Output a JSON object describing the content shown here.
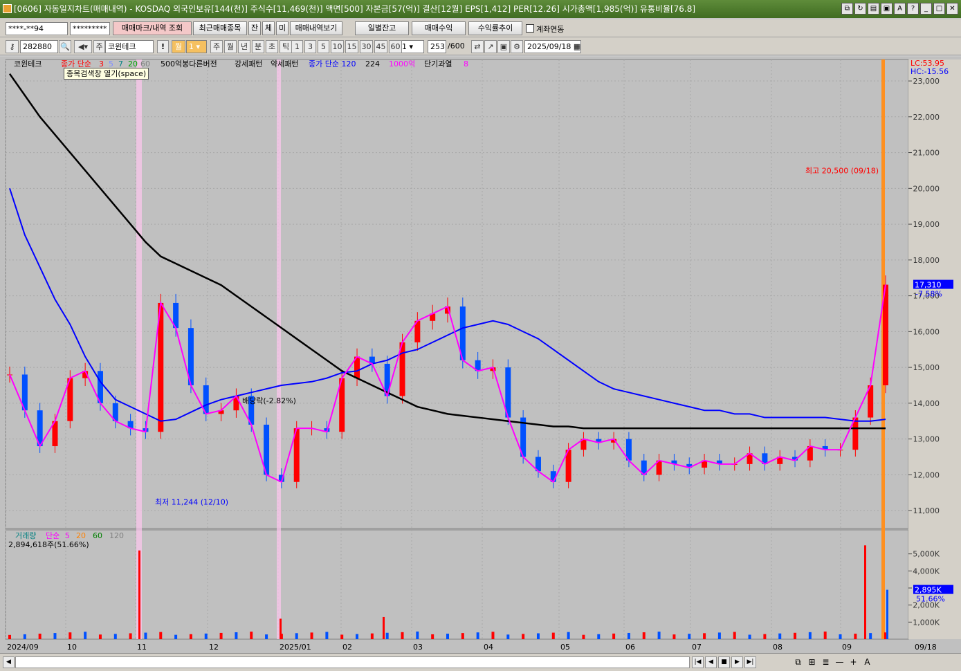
{
  "window": {
    "title": "[0606] 자동일지차트(매매내역) - KOSDAQ 외국인보유[144(천)] 주식수[11,469(천)] 액면[500] 자본금[57(억)] 결산[12월] EPS[1,412] PER[12.26] 시가총액[1,985(억)] 유통비율[76.8]"
  },
  "toolbar1": {
    "account": "****-**94",
    "password": "*********",
    "btn_mark": "매매마크/내역 조회",
    "btn_recent": "최근매매종목",
    "btn_jan": "잔",
    "btn_che": "체",
    "btn_mi": "미",
    "btn_detail": "매매내역보기",
    "btn_daily": "일별잔고",
    "btn_profit": "매매수익",
    "btn_rate": "수익률추이",
    "chk_account": "계좌연동"
  },
  "toolbar2": {
    "code": "282880",
    "name": "코윈테크",
    "cycle_selected": "월",
    "cycle_count": "1",
    "cycles": [
      "주",
      "월",
      "년",
      "분",
      "초",
      "틱"
    ],
    "minutes": [
      "1",
      "3",
      "5",
      "10",
      "15",
      "30",
      "45",
      "60"
    ],
    "min_value": "1",
    "count": "253",
    "count_max": "/600",
    "date": "2025/09/18",
    "tooltip": "종목검색창 열기(space)",
    "exclaim": "!",
    "prefix": "주"
  },
  "legend": {
    "stock": "코윈테크",
    "ma_label": "종가 단순",
    "ma_periods": [
      "3",
      "5",
      "7",
      "20",
      "60"
    ],
    "indicators": [
      "500억봉다른버전",
      "강세패턴",
      "약세패턴"
    ],
    "ma120": "종가 단순 120",
    "ma224": "224",
    "ma1000": "1000억",
    "short_label": "단기과열",
    "short_val": "8"
  },
  "price_axis": {
    "lc": "LC:53.95",
    "hc": "HC:-15.56",
    "current": "17,310",
    "change": "-7.58%",
    "ticks": [
      "23,000",
      "22,000",
      "21,000",
      "20,000",
      "19,000",
      "18,000",
      "17,000",
      "16,000",
      "15,000",
      "14,000",
      "13,000",
      "12,000",
      "11,000"
    ]
  },
  "annotations": {
    "high": "최고 20,500 (09/18)",
    "low": "최저 11,244 (12/10)",
    "dividend": "배당락(-2.82%)"
  },
  "volume": {
    "title": "거래량",
    "ma_label": "단순",
    "ma_periods": [
      "5",
      "20",
      "60",
      "120"
    ],
    "current": "2,894,618주(51.66%)",
    "axis_current": "2,895K",
    "axis_pct": "51.66%",
    "ticks": [
      "5,000K",
      "4,000K",
      "3,000K",
      "2,000K",
      "1,000K"
    ]
  },
  "x_axis": {
    "labels": [
      "2024/09",
      "10",
      "11",
      "12",
      "2025/01",
      "02",
      "03",
      "04",
      "05",
      "06",
      "07",
      "08",
      "09"
    ],
    "last": "09/18"
  },
  "colors": {
    "ma3": "#ff0000",
    "ma5": "#8090ff",
    "ma7": "#a0a0a0",
    "ma20": "#00a000",
    "ma60": "#a0a0a0",
    "ma120": "#0000ff",
    "ma224": "#000000",
    "ma1000": "#ff00ff",
    "short": "#ff00ff",
    "dividend": "#ff8080",
    "trade_buy": "#ff0000",
    "trade_sell": "#0000ff"
  },
  "chart_data": {
    "type": "candlestick",
    "title": "코윈테크",
    "x": [
      "2024/09",
      "10",
      "11",
      "12",
      "2025/01",
      "02",
      "03",
      "04",
      "05",
      "06",
      "07",
      "08",
      "09"
    ],
    "ylim": [
      10500,
      23600
    ],
    "series": [
      {
        "name": "종가",
        "values": [
          14800,
          13800,
          12800,
          13500,
          14700,
          14900,
          14000,
          13500,
          13300,
          13200,
          16800,
          16100,
          14500,
          13700,
          13800,
          14200,
          13400,
          12000,
          11800,
          13300,
          13300,
          13200,
          14700,
          15300,
          15100,
          14200,
          15700,
          16300,
          16500,
          16700,
          15200,
          14900,
          15000,
          13600,
          12500,
          12100,
          11800,
          12700,
          13000,
          12900,
          13000,
          12400,
          12000,
          12400,
          12300,
          12200,
          12400,
          12300,
          12300,
          12600,
          12300,
          12500,
          12400,
          12800,
          12700,
          12700,
          13600,
          14500,
          17310
        ]
      },
      {
        "name": "종가 단순 120",
        "values": [
          20000,
          18700,
          17800,
          16900,
          16200,
          15300,
          14600,
          14100,
          13900,
          13700,
          13500,
          13550,
          13750,
          13950,
          14100,
          14200,
          14300,
          14400,
          14500,
          14550,
          14600,
          14700,
          14850,
          14900,
          15100,
          15200,
          15400,
          15500,
          15700,
          15900,
          16100,
          16200,
          16300,
          16200,
          16000,
          15800,
          15500,
          15200,
          14900,
          14600,
          14400,
          14300,
          14200,
          14100,
          14000,
          13900,
          13800,
          13800,
          13700,
          13700,
          13600,
          13600,
          13600,
          13600,
          13600,
          13550,
          13500,
          13500,
          13550
        ]
      },
      {
        "name": "224",
        "values": [
          23200,
          22600,
          22000,
          21500,
          21000,
          20500,
          20000,
          19500,
          19000,
          18500,
          18100,
          17900,
          17700,
          17500,
          17300,
          17000,
          16700,
          16400,
          16100,
          15800,
          15500,
          15200,
          14900,
          14700,
          14500,
          14300,
          14100,
          13900,
          13800,
          13700,
          13650,
          13600,
          13550,
          13500,
          13450,
          13400,
          13350,
          13350,
          13300,
          13300,
          13300,
          13300,
          13300,
          13300,
          13300,
          13300,
          13300,
          13300,
          13300,
          13300,
          13300,
          13300,
          13300,
          13300,
          13300,
          13300,
          13300,
          13300,
          13300
        ]
      }
    ],
    "annotations": {
      "high": 20500,
      "high_date": "09/18",
      "low": 11244,
      "low_date": "12/10",
      "dividend": "-2.82%"
    },
    "volume_spikes": [
      {
        "date": "11",
        "value": 5200
      },
      {
        "date": "2025/01",
        "value": 1200
      },
      {
        "date": "02",
        "value": 1300
      },
      {
        "date": "09",
        "value": 5500
      },
      {
        "date": "09",
        "value": 2895
      }
    ]
  }
}
